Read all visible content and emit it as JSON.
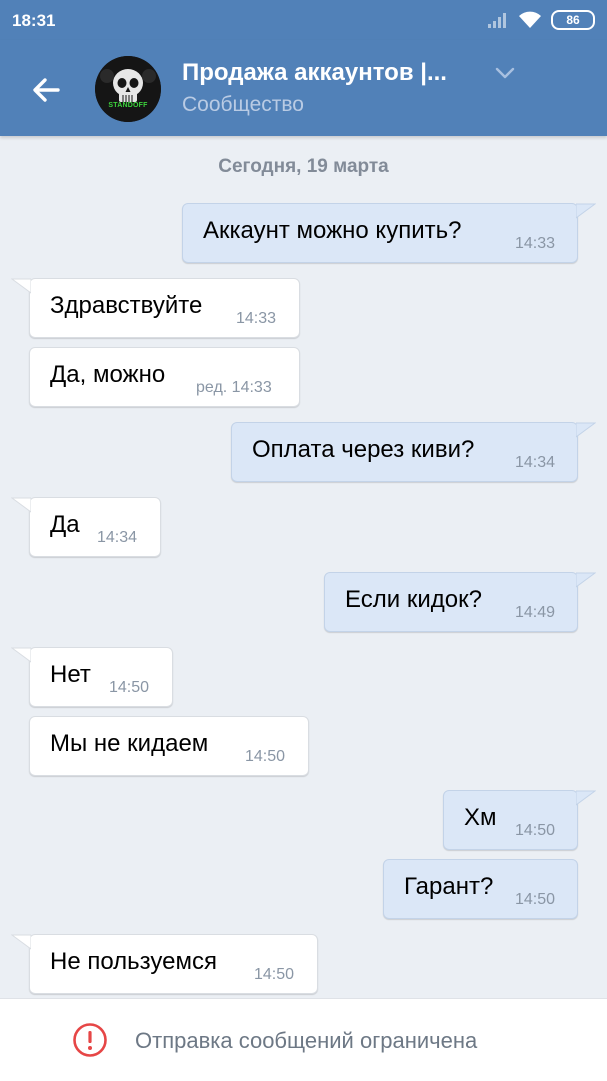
{
  "status_bar": {
    "time": "18:31",
    "battery": "86"
  },
  "header": {
    "title": "Продажа аккаунтов |...",
    "subtitle": "Сообщество",
    "avatar_label": "STANDOFF"
  },
  "chat": {
    "date_separator": "Сегодня, 19 марта",
    "messages": [
      {
        "dir": "out",
        "text": "Аккаунт можно купить?",
        "time": "14:33"
      },
      {
        "dir": "in",
        "text": "Здравствуйте",
        "time": "14:33"
      },
      {
        "dir": "in",
        "text": "Да, можно",
        "time": "ред. 14:33"
      },
      {
        "dir": "out",
        "text": "Оплата через киви?",
        "time": "14:34"
      },
      {
        "dir": "in",
        "text": "Да",
        "time": "14:34"
      },
      {
        "dir": "out",
        "text": "Если кидок?",
        "time": "14:49"
      },
      {
        "dir": "in",
        "text": "Нет",
        "time": "14:50"
      },
      {
        "dir": "in",
        "text": "Мы не кидаем",
        "time": "14:50"
      },
      {
        "dir": "out",
        "text": "Хм",
        "time": "14:50"
      },
      {
        "dir": "out",
        "text": "Гарант?",
        "time": "14:50"
      },
      {
        "dir": "in",
        "text": "Не пользуемся",
        "time": "14:50"
      }
    ]
  },
  "footer": {
    "restriction_text": "Отправка сообщений ограничена"
  },
  "colors": {
    "header_bg": "#5181b8",
    "chat_bg": "#ebeff4",
    "outgoing_bubble": "#dbe7f7",
    "incoming_bubble": "#ffffff",
    "warning_red": "#e64646"
  },
  "icons": [
    "back-arrow-icon",
    "chevron-down-icon",
    "signal-icon",
    "wifi-icon",
    "battery-icon",
    "warning-icon"
  ]
}
